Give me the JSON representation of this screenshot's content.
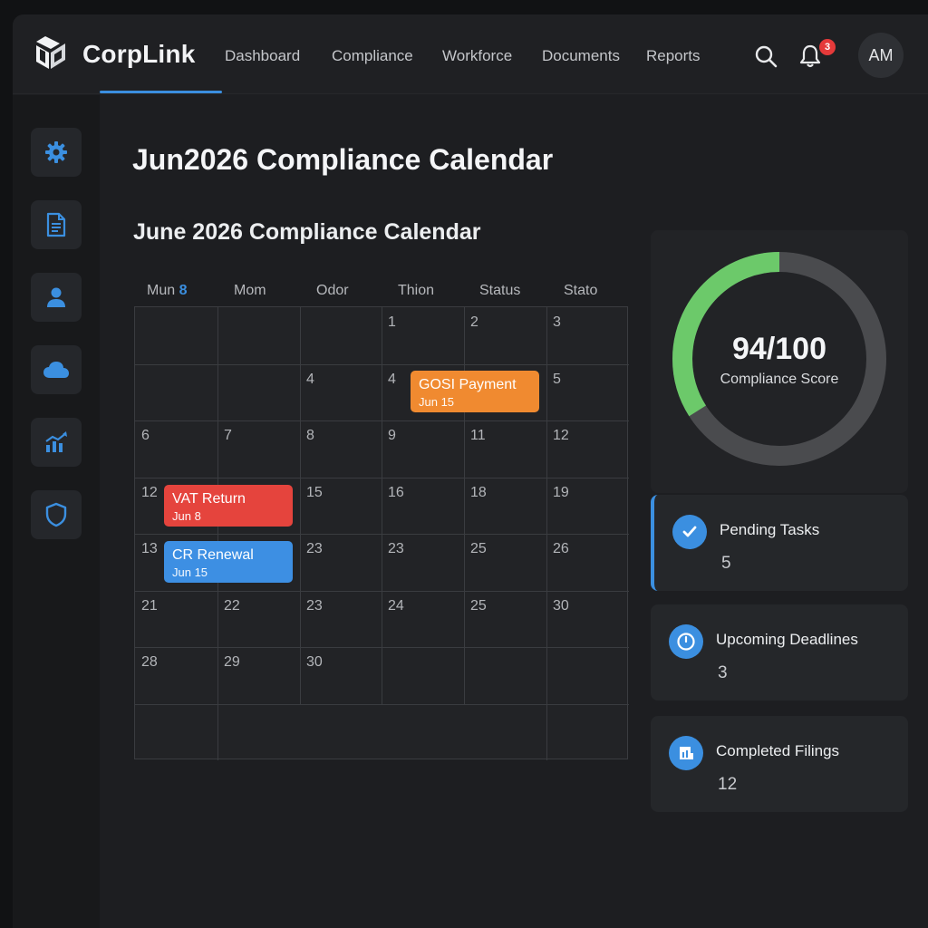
{
  "app": {
    "brand": "CorpLink"
  },
  "nav": {
    "items": [
      {
        "label": "Dashboard",
        "active": true
      },
      {
        "label": "Compliance"
      },
      {
        "label": "Workforce"
      },
      {
        "label": "Documents"
      },
      {
        "label": "Reports"
      }
    ],
    "notification_count": "3",
    "avatar_initials": "AM"
  },
  "sidebar": {
    "items": [
      {
        "icon": "gear-icon"
      },
      {
        "icon": "document-icon"
      },
      {
        "icon": "user-icon"
      },
      {
        "icon": "cloud-icon"
      },
      {
        "icon": "chart-icon"
      },
      {
        "icon": "shield-icon"
      }
    ]
  },
  "page": {
    "title": "Jun2026 Compliance Calendar",
    "calendar_title": "June 2026 Compliance Calendar"
  },
  "calendar": {
    "headers": [
      {
        "text": "Mun ",
        "accent": "8"
      },
      {
        "text": "Mom",
        "accent": ""
      },
      {
        "text": "Odor",
        "accent": ""
      },
      {
        "text": "Thion",
        "accent": ""
      },
      {
        "text": "Status",
        "accent": ""
      },
      {
        "text": "Stato",
        "accent": ""
      }
    ],
    "rows": [
      [
        "",
        "",
        "",
        "1",
        "2",
        "3"
      ],
      [
        "",
        "",
        "4",
        "4",
        "",
        "5"
      ],
      [
        "6",
        "7",
        "8",
        "9",
        "11",
        "12"
      ],
      [
        "12",
        "",
        "15",
        "16",
        "18",
        "19"
      ],
      [
        "13",
        "",
        "23",
        "23",
        "25",
        "26"
      ],
      [
        "21",
        "22",
        "23",
        "24",
        "25",
        "30"
      ],
      [
        "28",
        "29",
        "30",
        "",
        "",
        ""
      ],
      [
        "",
        "",
        "",
        "",
        "",
        ""
      ]
    ],
    "events": [
      {
        "title": "GOSI Payment",
        "date": "Jun 15",
        "color": "#f08a30"
      },
      {
        "title": "VAT Return",
        "date": "Jun 8",
        "color": "#e5443d"
      },
      {
        "title": "CR Renewal",
        "date": "Jun 15",
        "color": "#3d8fe3"
      }
    ]
  },
  "score": {
    "value": "94/100",
    "label": "Compliance Score",
    "fraction": 0.34,
    "color": "#6cc96a",
    "track_color": "#4a4b4e"
  },
  "stats": [
    {
      "label": "Pending Tasks",
      "value": "5",
      "icon": "check-circle-icon"
    },
    {
      "label": "Upcoming Deadlines",
      "value": "3",
      "icon": "clock-icon"
    },
    {
      "label": "Completed Filings",
      "value": "12",
      "icon": "filing-icon"
    }
  ],
  "colors": {
    "accent": "#3b8fe0",
    "badge": "#e53a3a"
  }
}
